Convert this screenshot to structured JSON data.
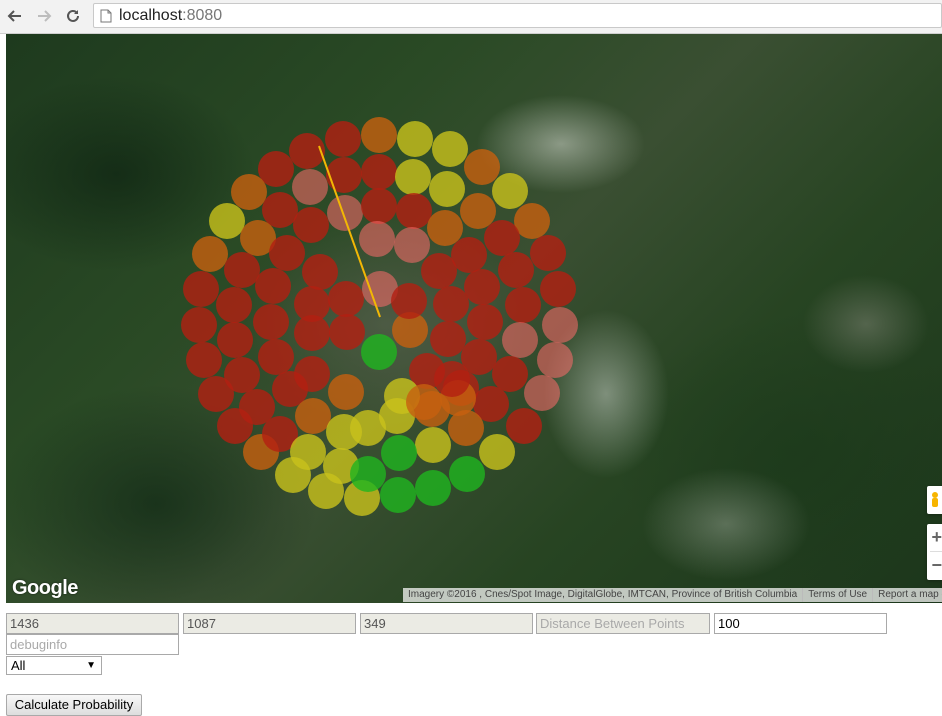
{
  "browser": {
    "url_host": "localhost",
    "url_port": ":8080"
  },
  "map": {
    "logo_text": "Google",
    "attribution": [
      "Imagery ©2016 , Cnes/Spot Image, DigitalGlobe, IMTCAN, Province of British Columbia",
      "Terms of Use",
      "Report a map e"
    ],
    "zoom_in_label": "+",
    "zoom_out_label": "−",
    "colors": {
      "red": "#b31f12",
      "red_light": "#ff6b6b",
      "orange": "#c7600f",
      "yellow": "#c9c21c",
      "green": "#1fb51f",
      "path_line": "#f2b705"
    }
  },
  "inputs": {
    "field1": "1436",
    "field2": "1087",
    "field3": "349",
    "distance_placeholder": "Distance Between Points",
    "distance_value": "100",
    "debug_placeholder": "debuginfo"
  },
  "filter_select": {
    "selected": "All"
  },
  "calculate_button": "Calculate Probability"
}
